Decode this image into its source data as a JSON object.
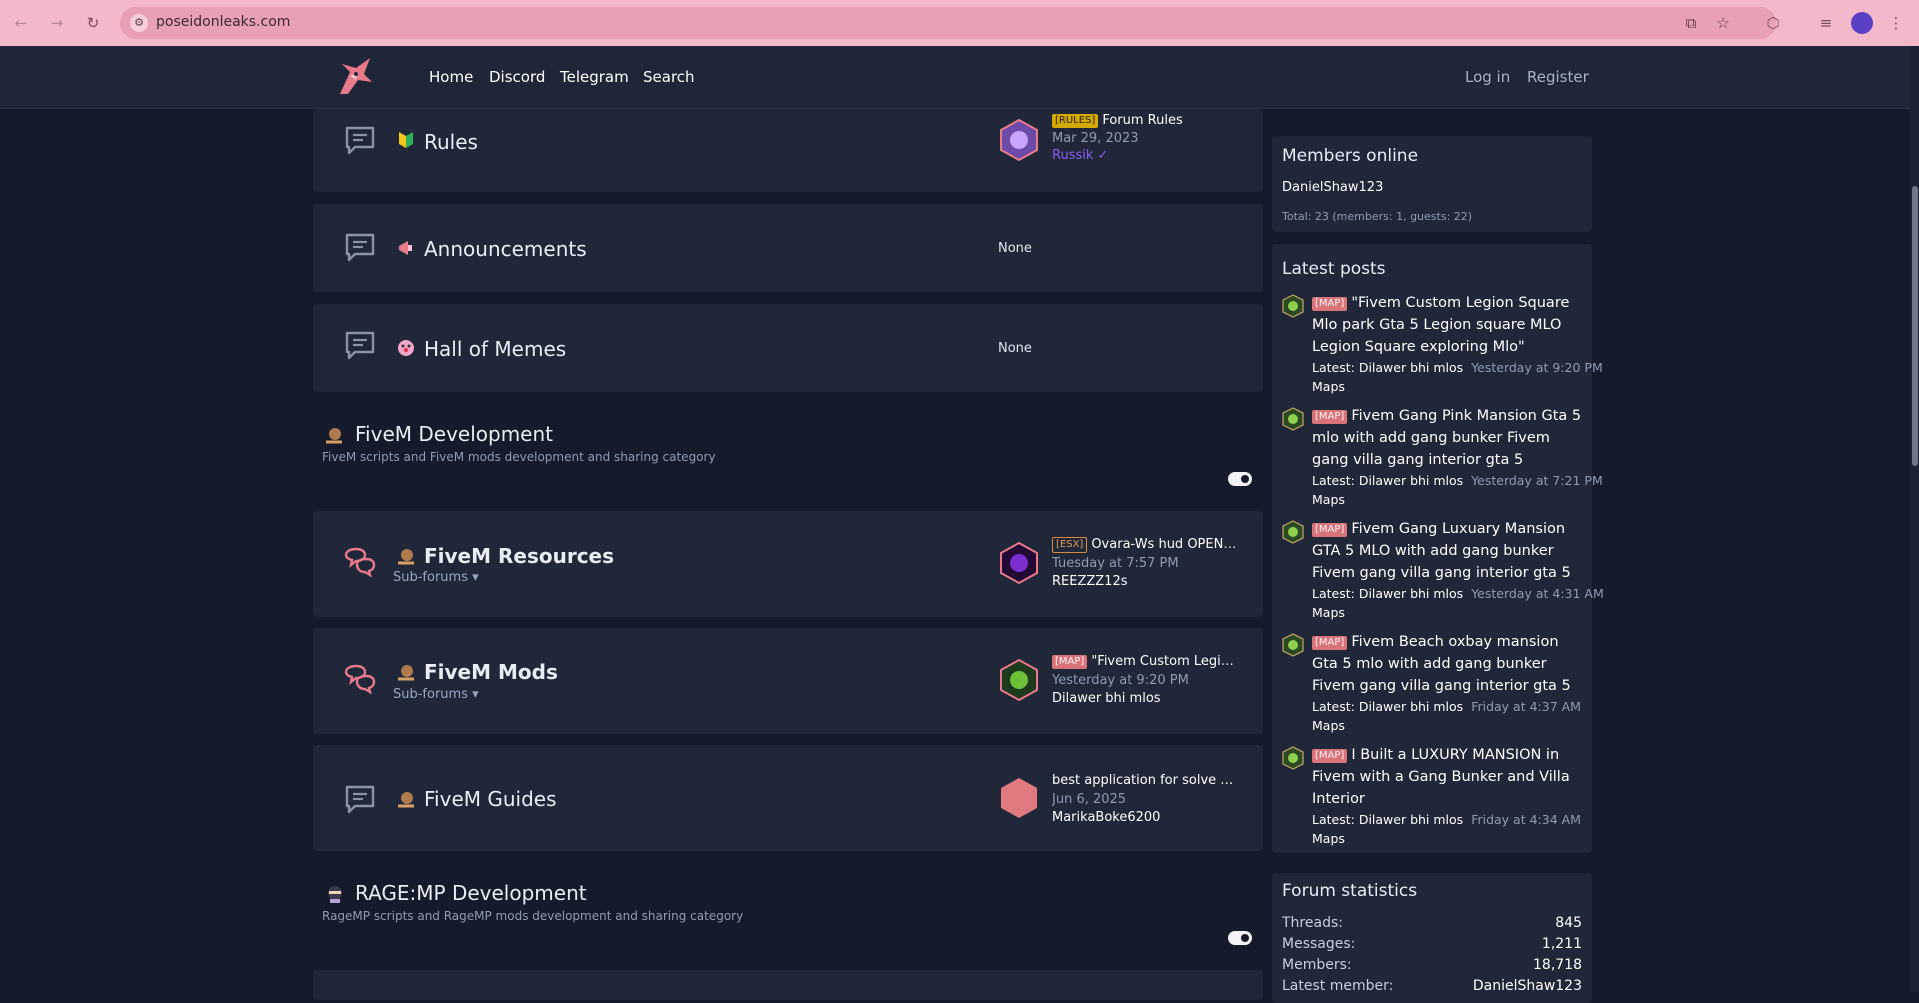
{
  "browser": {
    "url": "poseidonleaks.com"
  },
  "nav": {
    "home": "Home",
    "discord": "Discord",
    "telegram": "Telegram",
    "search": "Search",
    "login": "Log in",
    "register": "Register"
  },
  "forums": {
    "rules": {
      "title": "Rules",
      "prefix": "[RULES]",
      "last_title": "Forum Rules",
      "last_date": "Mar 29, 2023",
      "last_user": "Russik"
    },
    "announcements": {
      "title": "Announcements",
      "last": "None"
    },
    "memes": {
      "title": "Hall of Memes",
      "last": "None"
    }
  },
  "categories": {
    "fivem": {
      "title": "FiveM Development",
      "desc": "FiveM scripts and FiveM mods development and sharing category"
    },
    "ragemp": {
      "title": "RAGE:MP Development",
      "desc": "RageMP scripts and RageMP mods development and sharing category"
    }
  },
  "fivem_forums": {
    "resources": {
      "title": "FiveM Resources",
      "subforums": "Sub-forums",
      "prefix": "[ESX]",
      "last_title": "Ovara-Ws hud OPEN SOURCE",
      "last_date": "Tuesday at 7:57 PM",
      "last_user": "REEZZZ12s"
    },
    "mods": {
      "title": "FiveM Mods",
      "subforums": "Sub-forums",
      "prefix": "[MAP]",
      "last_title": "\"Fivem Custom Legion Square Mlo park\"",
      "last_date": "Yesterday at 9:20 PM",
      "last_user": "Dilawer bhi mlos"
    },
    "guides": {
      "title": "FiveM Guides",
      "last_title": "best application for solve Google Maps problems",
      "last_date": "Jun 6, 2025",
      "last_user": "MarikaBoke6200"
    }
  },
  "sidebar": {
    "online": {
      "title": "Members online",
      "member": "DanielShaw123",
      "total": "Total: 23 (members: 1, guests: 22)"
    },
    "latest": {
      "title": "Latest posts",
      "posts": [
        {
          "prefix": "[MAP]",
          "title": "\"Fivem Custom Legion Square Mlo park Gta 5 Legion square MLO Legion Square exploring Mlo\"",
          "latest": "Latest: Dilawer bhi mlos",
          "date": "Yesterday at 9:20 PM",
          "forum": "Maps"
        },
        {
          "prefix": "[MAP]",
          "title": "Fivem Gang Pink Mansion Gta 5 mlo with add gang bunker Fivem gang villa gang interior gta 5",
          "latest": "Latest: Dilawer bhi mlos",
          "date": "Yesterday at 7:21 PM",
          "forum": "Maps"
        },
        {
          "prefix": "[MAP]",
          "title": "Fivem Gang Luxuary Mansion GTA 5 MLO with add gang bunker Fivem gang villa gang interior gta 5",
          "latest": "Latest: Dilawer bhi mlos",
          "date": "Yesterday at 4:31 AM",
          "forum": "Maps"
        },
        {
          "prefix": "[MAP]",
          "title": "Fivem Beach oxbay mansion Gta 5 mlo with add gang bunker Fivem gang villa gang interior gta 5",
          "latest": "Latest: Dilawer bhi mlos",
          "date": "Friday at 4:37 AM",
          "forum": "Maps"
        },
        {
          "prefix": "[MAP]",
          "title": "I Built a LUXURY MANSION in Fivem with a Gang Bunker and Villa Interior",
          "latest": "Latest: Dilawer bhi mlos",
          "date": "Friday at 4:34 AM",
          "forum": "Maps"
        }
      ]
    },
    "stats": {
      "title": "Forum statistics",
      "threads_label": "Threads:",
      "threads": "845",
      "messages_label": "Messages:",
      "messages": "1,211",
      "members_label": "Members:",
      "members": "18,718",
      "latest_label": "Latest member:",
      "latest": "DanielShaw123"
    }
  },
  "colors": {
    "accent": "#e8798a",
    "prefix_map": "#d9737a",
    "prefix_rules": "#d4a900",
    "username_rules": "#8b5cf6"
  }
}
